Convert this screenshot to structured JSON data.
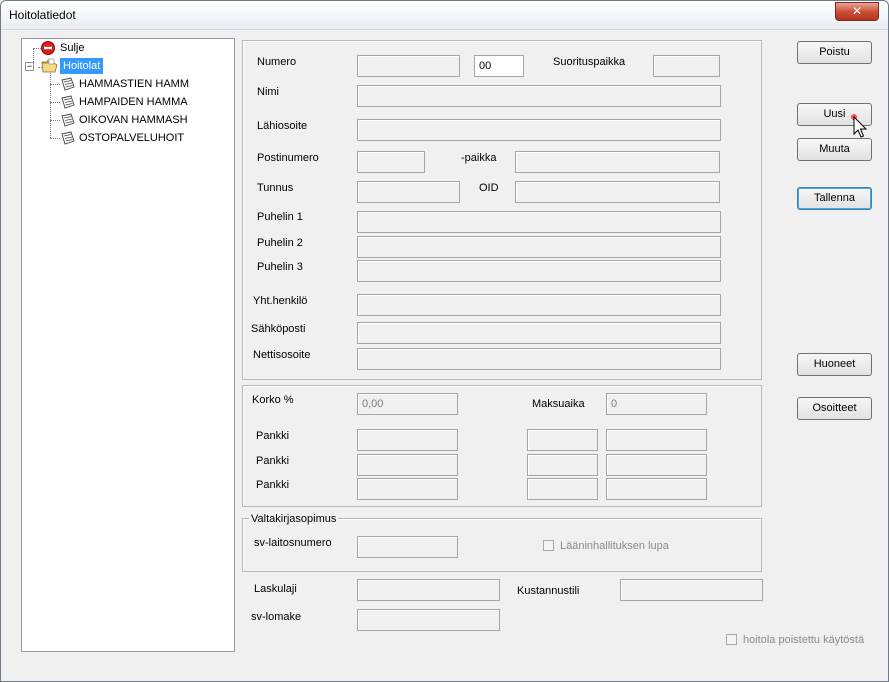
{
  "window": {
    "title": "Hoitolatiedot",
    "close_glyph": "✕"
  },
  "tree": {
    "items": [
      {
        "label": "Sulje",
        "icon": "stop-icon"
      },
      {
        "label": "Hoitolat",
        "icon": "folder-open-icon",
        "expander": "−"
      },
      {
        "label": "HAMMASTIEN HAMM",
        "icon": "document-icon"
      },
      {
        "label": "HAMPAIDEN HAMMA",
        "icon": "document-icon"
      },
      {
        "label": "OIKOVAN HAMMASH",
        "icon": "document-icon"
      },
      {
        "label": "OSTOPALVELUHOIT",
        "icon": "document-icon"
      }
    ]
  },
  "form": {
    "numero_label": "Numero",
    "numero_suffix_value": "00",
    "suorituspaikka_label": "Suorituspaikka",
    "nimi_label": "Nimi",
    "lahiosoite_label": "Lähiosoite",
    "postinumero_label": "Postinumero",
    "paikka_label": "-paikka",
    "tunnus_label": "Tunnus",
    "oid_label": "OID",
    "puhelin1_label": "Puhelin 1",
    "puhelin2_label": "Puhelin 2",
    "puhelin3_label": "Puhelin 3",
    "yht_label": "Yht.henkilö",
    "sahkoposti_label": "Sähköposti",
    "nettisosoite_label": "Nettisosoite"
  },
  "bank": {
    "korko_label": "Korko %",
    "korko_value": "0,00",
    "maksuaika_label": "Maksuaika",
    "maksuaika_value": "0",
    "pankki_labels": [
      "Pankki",
      "Pankki",
      "Pankki"
    ]
  },
  "valtakirja": {
    "title": "Valtakirjasopimus",
    "sv_laitos_label": "sv-laitosnumero",
    "laanin_label": "Lääninhallituksen lupa"
  },
  "bottom": {
    "laskulaji_label": "Laskulaji",
    "kustannustili_label": "Kustannustili",
    "sv_lomake_label": "sv-lomake",
    "poistettu_label": "hoitola poistettu käytöstä"
  },
  "buttons": {
    "poistu": "Poistu",
    "uusi": "Uusi",
    "muuta": "Muuta",
    "tallenna": "Tallenna",
    "huoneet": "Huoneet",
    "osoitteet": "Osoitteet"
  }
}
